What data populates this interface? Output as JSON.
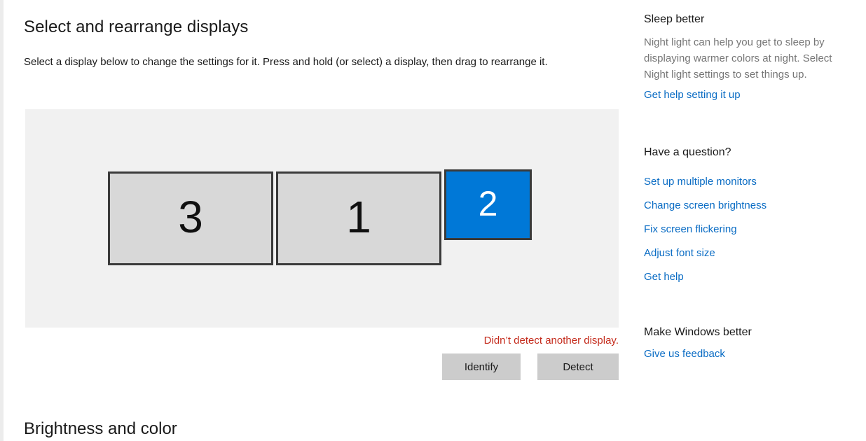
{
  "main": {
    "heading": "Select and rearrange displays",
    "instruction": "Select a display below to change the settings for it. Press and hold (or select) a display, then drag to rearrange it.",
    "displays": [
      {
        "label": "3",
        "selected": false
      },
      {
        "label": "1",
        "selected": false
      },
      {
        "label": "2",
        "selected": true
      }
    ],
    "detect_message": "Didn’t detect another display.",
    "identify_button": "Identify",
    "detect_button": "Detect",
    "bottom_heading": "Brightness and color"
  },
  "sidebar": {
    "sleep": {
      "title": "Sleep better",
      "body": "Night light can help you get to sleep by displaying warmer colors at night. Select Night light settings to set things up.",
      "link": "Get help setting it up"
    },
    "question": {
      "title": "Have a question?",
      "links": [
        "Set up multiple monitors",
        "Change screen brightness",
        "Fix screen flickering",
        "Adjust font size",
        "Get help"
      ]
    },
    "feedback": {
      "title": "Make Windows better",
      "link": "Give us feedback"
    }
  },
  "colors": {
    "accent_blue": "#0078D7",
    "link_blue": "#0A6CC4",
    "error_red": "#C42B1C",
    "panel_gray": "#F1F1F1",
    "monitor_fill": "#D8D8D8",
    "monitor_border": "#3A3A3A",
    "button_gray": "#CCCCCC",
    "muted_text": "#767676"
  }
}
